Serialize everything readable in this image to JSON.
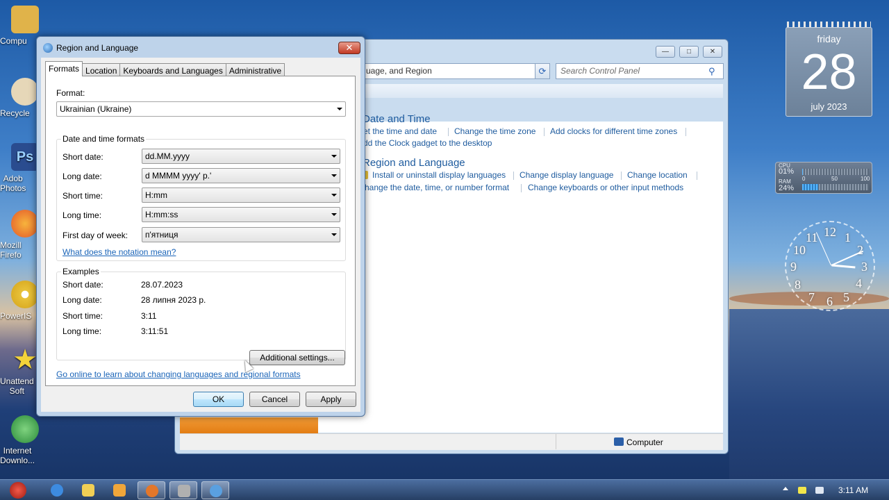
{
  "desktop": {
    "icons": [
      {
        "label": "Compu",
        "color": "#e0b34a"
      },
      {
        "label": "Recycle",
        "color": "#e6d7b8"
      },
      {
        "label": "Adob\nPhotos",
        "color": "#2a4c8f"
      },
      {
        "label": "Mozill\nFirefo",
        "color": "#e3772a"
      },
      {
        "label": "PowerIS",
        "color": "#e8c23a"
      },
      {
        "label": "Unattend\nSoft",
        "color": "#f3d33a"
      },
      {
        "label": "Internet\nDownlo...",
        "color": "#3b9b3f"
      }
    ]
  },
  "control_panel": {
    "address": "uage, and Region",
    "search_placeholder": "Search Control Panel",
    "date_time": {
      "heading": "Date and Time",
      "links": [
        "et the time and date",
        "Change the time zone",
        "Add clocks for different time zones",
        "dd the Clock gadget to the desktop"
      ]
    },
    "region_language": {
      "heading": "Region and Language",
      "links": [
        "Install or uninstall display languages",
        "Change display language",
        "Change location",
        "hange the date, time, or number format",
        "Change keyboards or other input methods"
      ]
    },
    "status": "Computer",
    "buttons": {
      "minimize": "—",
      "maximize": "□",
      "close": "✕"
    }
  },
  "dialog": {
    "title": "Region and Language",
    "close_label": "✕",
    "tabs": [
      "Formats",
      "Location",
      "Keyboards and Languages",
      "Administrative"
    ],
    "active_tab": "Formats",
    "format_label": "Format:",
    "format_value": "Ukrainian (Ukraine)",
    "date_time_group": {
      "title": "Date and time formats",
      "rows": [
        {
          "label": "Short date:",
          "value": "dd.MM.yyyy"
        },
        {
          "label": "Long date:",
          "value": "d MMMM yyyy' р.'"
        },
        {
          "label": "Short time:",
          "value": "H:mm"
        },
        {
          "label": "Long time:",
          "value": "H:mm:ss"
        },
        {
          "label": "First day of week:",
          "value": "п'ятниця"
        }
      ],
      "notation_link": "What does the notation mean?"
    },
    "examples_group": {
      "title": "Examples",
      "rows": [
        {
          "label": "Short date:",
          "value": "28.07.2023"
        },
        {
          "label": "Long date:",
          "value": "28 липня 2023 р."
        },
        {
          "label": "Short time:",
          "value": "3:11"
        },
        {
          "label": "Long time:",
          "value": "3:11:51"
        }
      ]
    },
    "additional_settings": "Additional settings...",
    "online_link": "Go online to learn about changing languages and regional formats",
    "buttons": {
      "ok": "OK",
      "cancel": "Cancel",
      "apply": "Apply"
    }
  },
  "gadgets": {
    "calendar": {
      "day": "friday",
      "date": "28",
      "month": "july 2023"
    },
    "meter": {
      "cpu_label": "CPU",
      "cpu_value": "01%",
      "cpu_fraction": 0.01,
      "ram_label": "RAM",
      "ram_value": "24%",
      "ram_fraction": 0.24,
      "scale": [
        "0",
        "50",
        "100"
      ]
    },
    "clock": {
      "numbers": [
        "12",
        "1",
        "2",
        "3",
        "4",
        "5",
        "6",
        "7",
        "8",
        "9",
        "10",
        "11"
      ]
    }
  },
  "taskbar": {
    "time": "3:11 AM",
    "buttons": [
      {
        "name": "start-button",
        "color": "#d83a2b"
      },
      {
        "name": "ie-button",
        "color": "#3d8be0"
      },
      {
        "name": "explorer-button",
        "color": "#f0cf55"
      },
      {
        "name": "media-player-button",
        "color": "#f0a63a"
      },
      {
        "name": "firefox-button",
        "color": "#e3772a"
      },
      {
        "name": "app-button",
        "color": "#b0b0b0"
      },
      {
        "name": "control-panel-button",
        "color": "#5aa0e0"
      }
    ]
  }
}
